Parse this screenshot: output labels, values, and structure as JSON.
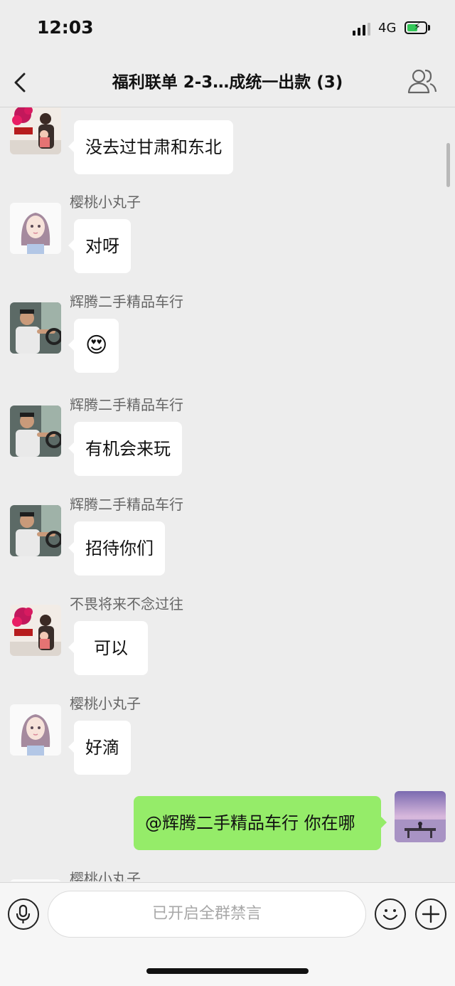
{
  "status": {
    "time": "12:03",
    "network": "4G"
  },
  "navbar": {
    "title": "福利联单 2-3…成统一出款 (3)"
  },
  "messages": [
    {
      "sender": "",
      "text": "没去过甘肃和东北",
      "avatar": "flower-portrait-avatar"
    },
    {
      "sender": "樱桃小丸子",
      "text": "对呀",
      "avatar": "illustrated-girl-avatar"
    },
    {
      "sender": "辉腾二手精品车行",
      "text": "😍",
      "avatar": "driver-avatar"
    },
    {
      "sender": "辉腾二手精品车行",
      "text": "有机会来玩",
      "avatar": "driver-avatar"
    },
    {
      "sender": "辉腾二手精品车行",
      "text": "招待你们",
      "avatar": "driver-avatar"
    },
    {
      "sender": "不畏将来不念过往",
      "text": "可以",
      "avatar": "flower-portrait-avatar"
    },
    {
      "sender": "樱桃小丸子",
      "text": "好滴",
      "avatar": "illustrated-girl-avatar"
    },
    {
      "sender": "",
      "text": "@辉腾二手精品车行 你在哪",
      "avatar": "lake-pier-avatar",
      "self": true
    },
    {
      "sender": "樱桃小丸子",
      "text": "",
      "avatar": "illustrated-girl-avatar"
    }
  ],
  "input": {
    "placeholder": "已开启全群禁言"
  },
  "colors": {
    "self_bubble": "#95ec69",
    "background": "#ededed"
  }
}
